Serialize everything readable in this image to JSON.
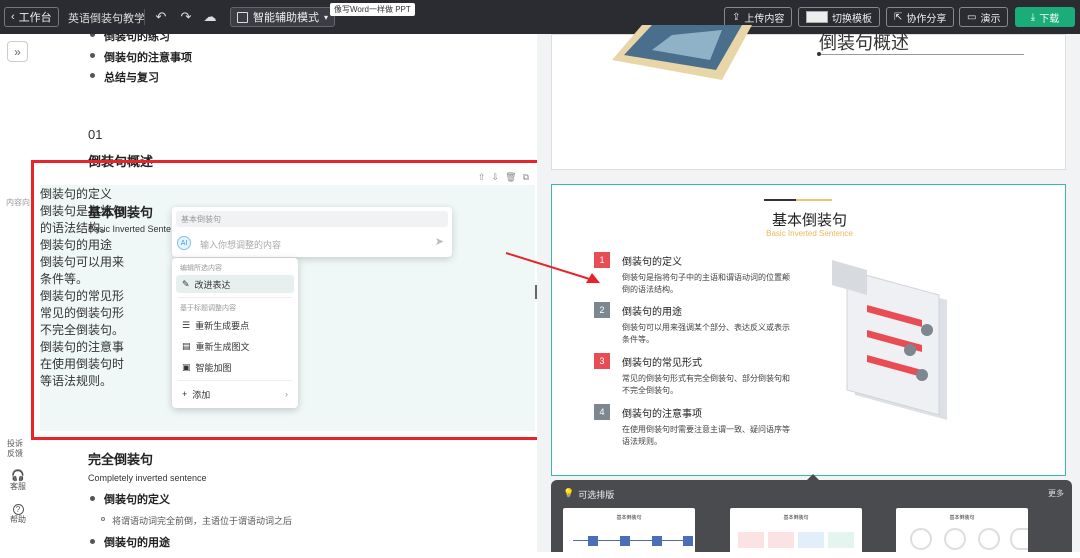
{
  "topbar": {
    "back_label": "工作台",
    "doc_name": "英语倒装句教学",
    "mode_label": "智能辅助模式",
    "mode_tip": "像写Word一样做 PPT",
    "upload_label": "上传内容",
    "switch_template_label": "切换模板",
    "share_label": "协作分享",
    "present_label": "演示",
    "download_label": "下载"
  },
  "leftrail": {
    "outline_label": "内容向",
    "feedback_label": "投诉反馈",
    "service_label": "客服",
    "help_label": "帮助"
  },
  "doc": {
    "toc_items": [
      "倒装句的练习",
      "倒装句的注意事项",
      "总结与复习"
    ],
    "chapter_num": "01",
    "chapter_title": "倒装句概述",
    "section1": {
      "title": "基本倒装句",
      "subtitle": "Basic Inverted Sente",
      "points": [
        {
          "title": "倒装句的定义",
          "desc": "倒装句是指将句",
          "desc_tail": "的语法结构。"
        },
        {
          "title": "倒装句的用途",
          "desc": "倒装句可以用来",
          "desc_tail": "条件等。"
        },
        {
          "title": "倒装句的常见形",
          "desc": "常见的倒装句形",
          "desc_tail": "不完全倒装句。"
        },
        {
          "title": "倒装句的注意事",
          "desc": "在使用倒装句时",
          "desc_tail": "等语法规则。"
        }
      ]
    },
    "section2": {
      "title": "完全倒装句",
      "subtitle": "Completely inverted sentence",
      "points": [
        {
          "title": "倒装句的定义",
          "desc": "将谓语动词完全前倒，主语位于谓语动词之后"
        },
        {
          "title": "倒装句的用途"
        }
      ]
    }
  },
  "ai_popup": {
    "context_label": "基本倒装句",
    "input_placeholder": "输入你想调整的内容"
  },
  "ai_menu": {
    "group1_label": "编辑所选内容",
    "improve_label": "改进表达",
    "group2_label": "基于标题调整内容",
    "regen_points_label": "重新生成要点",
    "regen_rich_label": "重新生成图文",
    "smart_image_label": "智能加图",
    "add_label": "添加"
  },
  "slides": {
    "slide1_title": "倒装句概述",
    "slide2": {
      "title": "基本倒装句",
      "subtitle": "Basic Inverted Sentence",
      "items": [
        {
          "num": "1",
          "color": "#e84c55",
          "title": "倒装句的定义",
          "desc": "倒装句是指将句子中的主语和谓语动词的位置颠倒的语法结构。"
        },
        {
          "num": "2",
          "color": "#7d8790",
          "title": "倒装句的用途",
          "desc": "倒装句可以用来强调某个部分、表达反义或表示条件等。"
        },
        {
          "num": "3",
          "color": "#e84c55",
          "title": "倒装句的常见形式",
          "desc": "常见的倒装句形式有完全倒装句、部分倒装句和不完全倒装句。"
        },
        {
          "num": "4",
          "color": "#7d8790",
          "title": "倒装句的注意事项",
          "desc": "在使用倒装句时需要注意主谓一致、疑问语序等语法规则。"
        }
      ]
    }
  },
  "layouts": {
    "title": "可选排版",
    "more_label": "更多",
    "card_title": "基本倒装句"
  },
  "colors": {
    "accent": "#1aad7a",
    "highlight": "#e8232a",
    "slide_border": "#3bb6ad"
  }
}
